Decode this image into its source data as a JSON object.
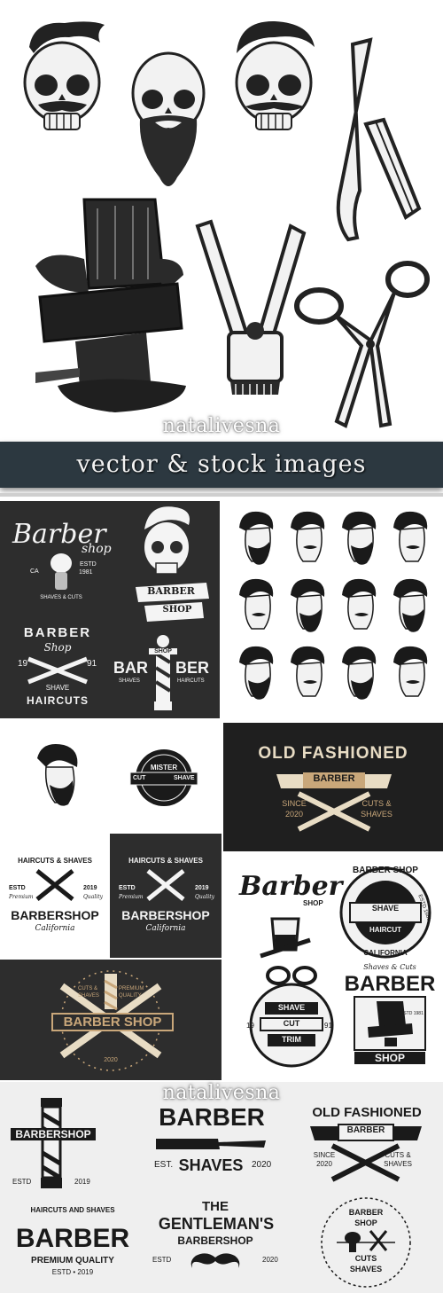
{
  "watermark": {
    "top": "natalivesna",
    "bottom": "natalivesna"
  },
  "banner": {
    "text": "vector & stock images"
  },
  "illustrations_top": {
    "icons": [
      "skull-hair-icon",
      "skull-beard-icon",
      "skull-mustache-icon",
      "razor-icon",
      "barber-chair-icon",
      "hair-clipper-icon",
      "scissors-icon"
    ]
  },
  "dark_panel_logos": {
    "logo1": {
      "title": "Barber",
      "sub": "shop",
      "ca": "CA",
      "estd": "ESTD",
      "year": "1981",
      "line": "SHAVES & CUTS"
    },
    "logo2": {
      "ribbon1": "BARBER",
      "ribbon2": "SHOP"
    },
    "logo3": {
      "top": "BARBER",
      "shop": "Shop",
      "y1": "19",
      "y2": "91",
      "bottom1": "SHAVE",
      "bottom2": "HAIRCUTS"
    },
    "logo4": {
      "left": "BAR",
      "mid": "SHOP",
      "right": "BER",
      "l2": "SHAVES",
      "r2": "HAIRCUTS"
    }
  },
  "mister_logo": {
    "top": "MISTER",
    "left": "CUT",
    "right": "SHAVE"
  },
  "old_fashioned_dark": {
    "title": "OLD FASHIONED",
    "ribbon": "BARBER",
    "since": "SINCE",
    "year": "2020",
    "cuts": "CUTS &",
    "shaves": "SHAVES"
  },
  "barbershop_ca_light": {
    "arc": "HAIRCUTS & SHAVES",
    "estd": "ESTD",
    "year": "2019",
    "prem": "Premium",
    "qual": "Quality",
    "title": "BARBERSHOP",
    "script": "California"
  },
  "barbershop_ca_dark": {
    "arc": "HAIRCUTS & SHAVES",
    "estd": "ESTD",
    "year": "2019",
    "prem": "Premium",
    "qual": "Quality",
    "title": "BARBERSHOP",
    "script": "California"
  },
  "barber_shop_dark": {
    "c1": "CUTS &",
    "c2": "SHAVES",
    "p1": "PREMIUM",
    "p2": "QUALITY",
    "title": "BARBER SHOP",
    "year": "2020"
  },
  "light_right_logos": {
    "barber_script": {
      "title": "Barber",
      "shop": "SHOP"
    },
    "barber_shop_round": {
      "arc": "BARBER SHOP",
      "r1": "SHAVE",
      "r2": "HAIRCUT",
      "side": "ESTD 1981",
      "bottom": "CALIFORNIA"
    },
    "shave_cut_trim": {
      "r1": "SHAVE",
      "r2": "CUT",
      "r3": "TRIM",
      "y1": "19",
      "y2": "91"
    },
    "barber_chair_logo": {
      "top": "Shaves & Cuts",
      "title": "BARBER",
      "estd": "ESTD 1981",
      "bottom": "SHOP"
    }
  },
  "bottom_panel": {
    "barbershop_pole": {
      "ribbon": "BARBERSHOP",
      "estd": "ESTD",
      "year": "2019"
    },
    "barber_shaves": {
      "title": "BARBER",
      "est": "EST.",
      "sub": "SHAVES",
      "year": "2020"
    },
    "old_fashioned": {
      "title": "OLD FASHIONED",
      "ribbon": "BARBER",
      "since": "SINCE",
      "year": "2020",
      "cuts": "CUTS &",
      "shaves": "SHAVES"
    },
    "premium": {
      "arc": "HAIRCUTS AND SHAVES",
      "title": "BARBER",
      "sub": "PREMIUM QUALITY",
      "year": "ESTD • 2019"
    },
    "gentleman": {
      "the": "THE",
      "title": "GENTLEMAN'S",
      "sub": "BARBERSHOP",
      "estd": "ESTD",
      "year": "2020"
    },
    "circle": {
      "t1": "BARBER",
      "t2": "SHOP",
      "b1": "CUTS",
      "b2": "SHAVES"
    }
  },
  "colors": {
    "dark": "#2d2d2d",
    "banner": "#2c3840",
    "accent": "#c9a77a",
    "cream": "#e8dcc4",
    "ink": "#1a1a1a"
  }
}
